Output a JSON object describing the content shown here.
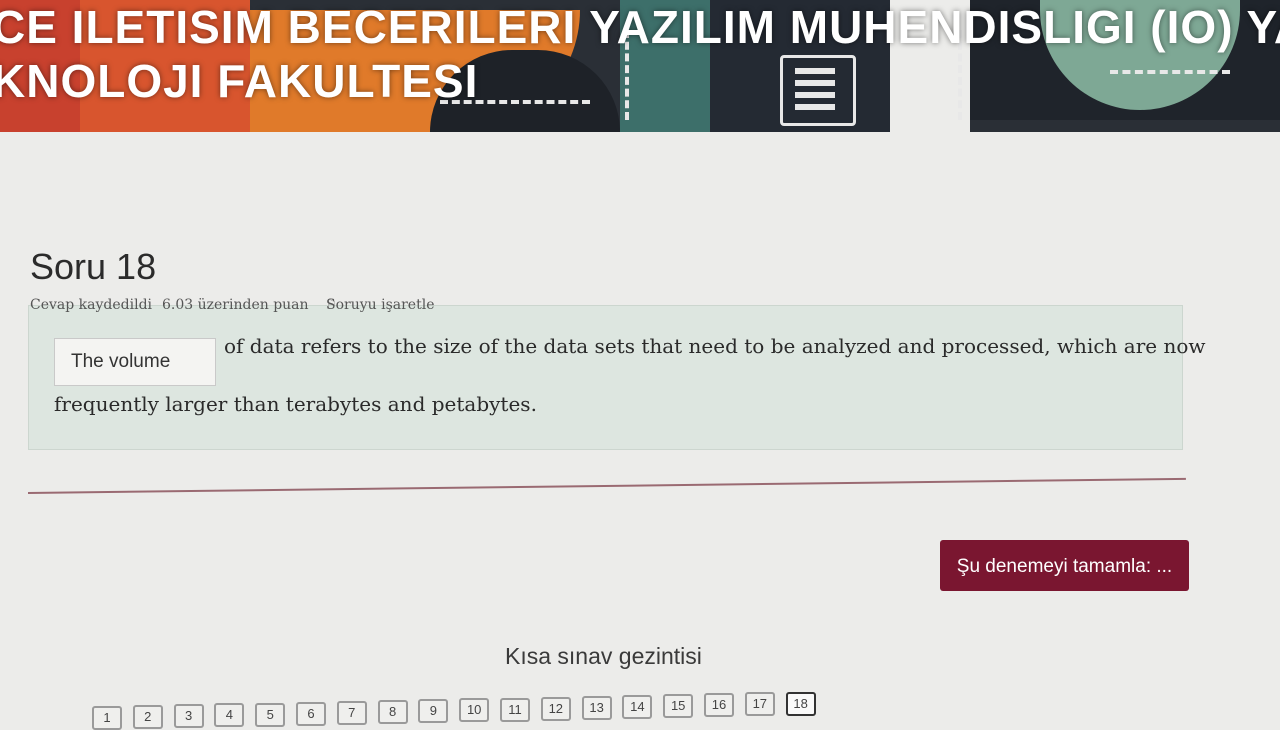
{
  "banner": {
    "title_line1": "CE ILETISIM BECERILERI YAZILIM MUHENDISLIGI (IO) YAZI",
    "title_line2": "KNOLOJI FAKULTESI"
  },
  "question": {
    "title": "Soru 18",
    "status": "Cevap kaydedildi",
    "points": "6.03 üzerinden puan",
    "flag_label": "Soruyu işaretle",
    "answer_value": "The volume",
    "text_part1": "of data refers to the size of the data sets that need to be analyzed and processed, which are now",
    "text_part2": "frequently larger than terabytes and petabytes."
  },
  "actions": {
    "finish_label": "Şu denemeyi tamamla: ..."
  },
  "navigation": {
    "title": "Kısa sınav gezintisi",
    "buttons": [
      "1",
      "2",
      "3",
      "4",
      "5",
      "6",
      "7",
      "8",
      "9",
      "10",
      "11",
      "12",
      "13",
      "14",
      "15",
      "16",
      "17",
      "18"
    ],
    "current": "18"
  },
  "colors": {
    "accent": "#7a1630",
    "question_bg": "#dde6e0",
    "page_bg": "#ececea"
  }
}
